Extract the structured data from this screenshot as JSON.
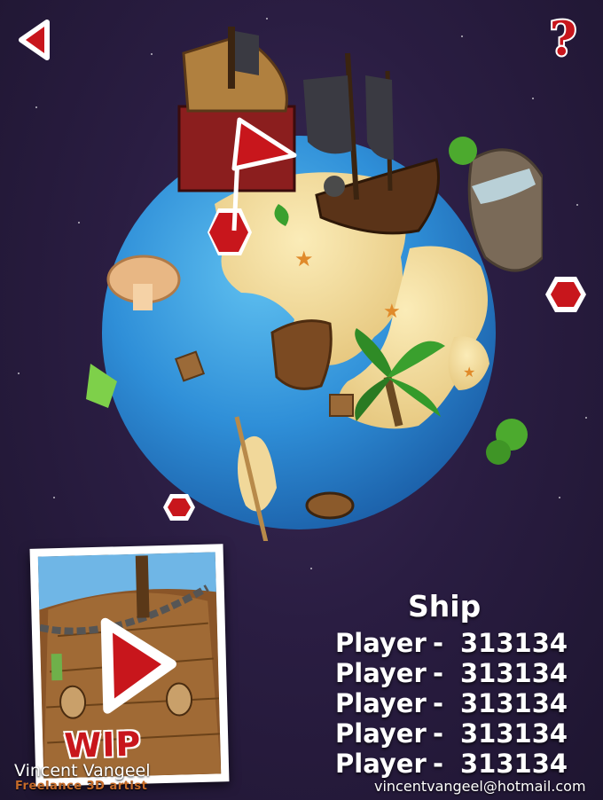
{
  "nav": {
    "back_icon": "back-arrow-icon",
    "help_icon": "question-mark-icon"
  },
  "level_card": {
    "badge": "WIP",
    "play_icon": "play-icon"
  },
  "leaderboard": {
    "title": "Ship",
    "rows": [
      {
        "name": "Player",
        "separator": "-",
        "score": "313134"
      },
      {
        "name": "Player",
        "separator": "-",
        "score": "313134"
      },
      {
        "name": "Player",
        "separator": "-",
        "score": "313134"
      },
      {
        "name": "Player",
        "separator": "-",
        "score": "313134"
      },
      {
        "name": "Player",
        "separator": "-",
        "score": "313134"
      }
    ]
  },
  "credits": {
    "author": "Vincent Vangeel",
    "role": "Freelance 3D artist",
    "email": "vincentvangeel@hotmail.com"
  },
  "colors": {
    "accent_red": "#c8161c",
    "ocean_blue": "#2f8fd8",
    "sand": "#f3dca0",
    "background": "#2a1d42"
  }
}
